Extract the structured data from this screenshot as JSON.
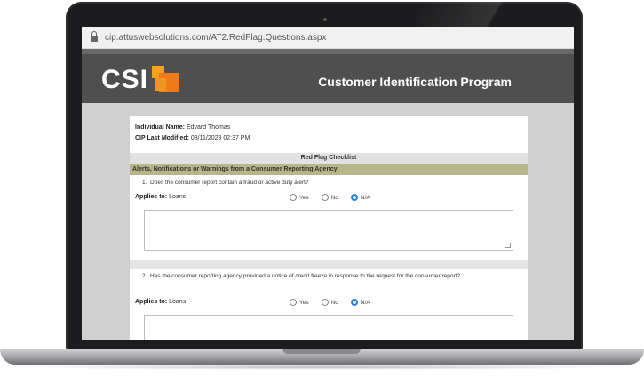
{
  "browser": {
    "url": "cip.attuswebsolutions.com/AT2.RedFlag.Questions.aspx"
  },
  "header": {
    "logo_text": "CSI",
    "program_title": "Customer Identification Program"
  },
  "info": {
    "individual_label": "Individual Name:",
    "individual_value": "Edvard Thomas",
    "modified_label": "CIP Last Modified:",
    "modified_value": "08/11/2023 02:37 PM"
  },
  "checklist": {
    "title": "Red Flag Checklist",
    "category": "Alerts, Notifications or Warnings from a Consumer Reporting Agency",
    "questions": [
      {
        "number": "1.",
        "text": "Does the consumer report contain a fraud or active duty alert?",
        "applies_label": "Applies to:",
        "applies_value": "Loans",
        "options": [
          "Yes",
          "No",
          "N/A"
        ],
        "selected": "N/A"
      },
      {
        "number": "2.",
        "text": "Has the consumer reporting agency provided a notice of credit freeze in response to the request for the consumer report?",
        "applies_label": "Applies to:",
        "applies_value": "Loans",
        "options": [
          "Yes",
          "No",
          "N/A"
        ],
        "selected": "N/A"
      }
    ]
  },
  "colors": {
    "header_bg": "#4f4f4f",
    "category_bg": "#b9b58a",
    "logo_orange": "#ee7a18",
    "radio_selected": "#2a7fe0"
  },
  "icons": {
    "lock": "lock-icon",
    "logo": "csi-logo-icon"
  }
}
